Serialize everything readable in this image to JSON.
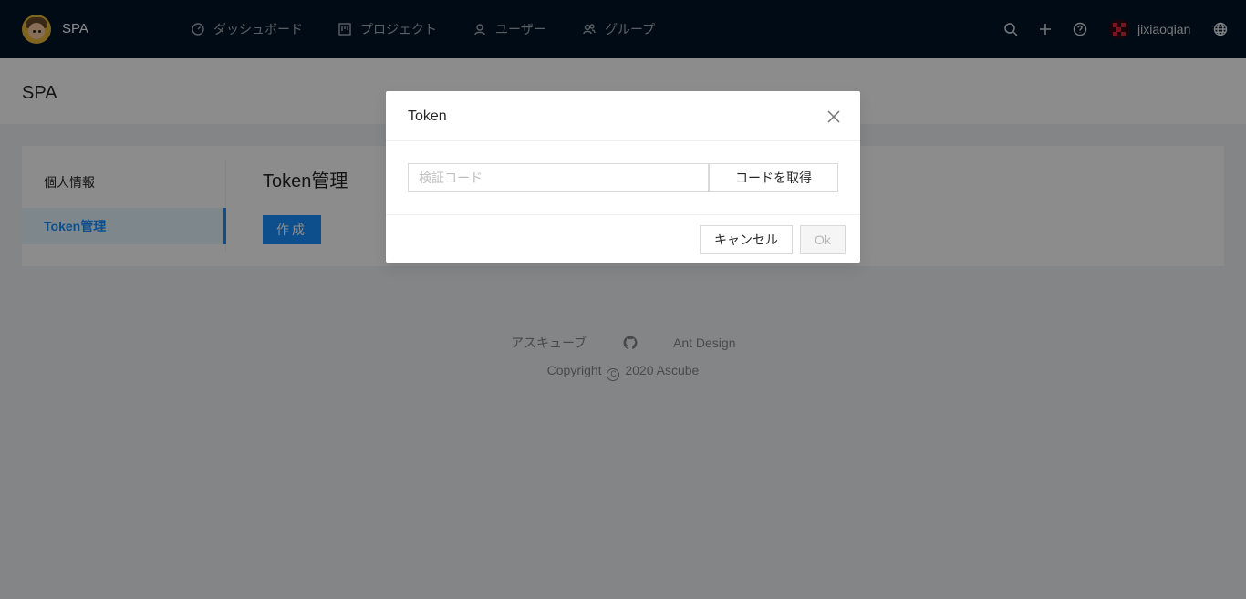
{
  "header": {
    "brand": "SPA",
    "nav": [
      {
        "label": "ダッシュボード",
        "icon": "dashboard-icon"
      },
      {
        "label": "プロジェクト",
        "icon": "project-icon"
      },
      {
        "label": "ユーザー",
        "icon": "user-icon"
      },
      {
        "label": "グループ",
        "icon": "team-icon"
      }
    ],
    "username": "jixiaoqian"
  },
  "page": {
    "title": "SPA"
  },
  "sidebar": {
    "items": [
      {
        "label": "個人情報",
        "active": false
      },
      {
        "label": "Token管理",
        "active": true
      }
    ]
  },
  "content": {
    "title": "Token管理",
    "create_label": "作成"
  },
  "footer": {
    "links": [
      "アスキューブ",
      "Ant Design"
    ],
    "copyright_prefix": "Copyright",
    "copyright_text": "2020 Ascube"
  },
  "modal": {
    "title": "Token",
    "code_placeholder": "検証コード",
    "code_value": "",
    "get_code_label": "コードを取得",
    "cancel_label": "キャンセル",
    "ok_label": "Ok"
  },
  "colors": {
    "header_bg": "#001529",
    "primary": "#1890ff",
    "active_bg": "#e6f7ff"
  }
}
